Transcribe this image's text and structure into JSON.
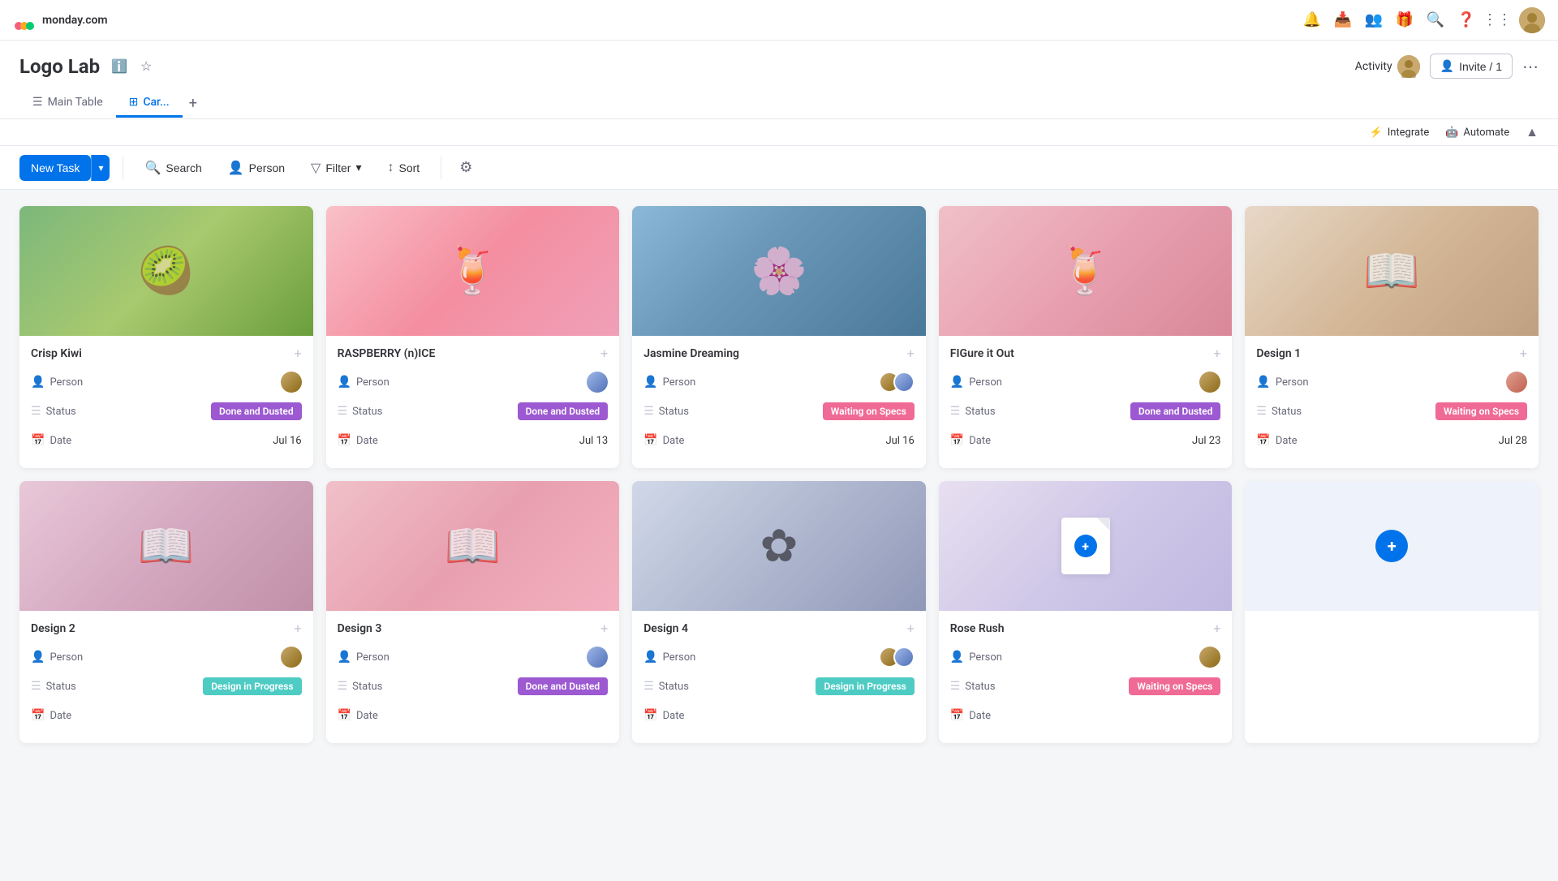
{
  "app": {
    "logo_text": "monday.com",
    "project_title": "Logo Lab"
  },
  "header": {
    "activity_label": "Activity",
    "invite_label": "Invite / 1"
  },
  "tabs": [
    {
      "id": "main-table",
      "label": "Main Table",
      "icon": "☰",
      "active": false
    },
    {
      "id": "card-view",
      "label": "Car...",
      "icon": "⊞",
      "active": true
    }
  ],
  "integrate_bar": {
    "integrate_label": "Integrate",
    "automate_label": "Automate"
  },
  "toolbar": {
    "new_task_label": "New Task",
    "search_label": "Search",
    "person_label": "Person",
    "filter_label": "Filter",
    "sort_label": "Sort"
  },
  "status": {
    "done": "Done and Dusted",
    "waiting": "Waiting on Specs",
    "progress": "Design in Progress"
  },
  "cards": [
    {
      "id": "crisp-kiwi",
      "title": "Crisp Kiwi",
      "bg": "bg-crisp-kiwi",
      "art": "🥝",
      "person_label": "Person",
      "status_label": "Status",
      "status_type": "done",
      "date_label": "Date",
      "date_value": "Jul 16",
      "avatar": "1"
    },
    {
      "id": "raspberry",
      "title": "RASPBERRY (n)ICE",
      "bg": "bg-raspberry",
      "art": "🍹",
      "person_label": "Person",
      "status_label": "Status",
      "status_type": "done",
      "date_label": "Date",
      "date_value": "Jul 13",
      "avatar": "2"
    },
    {
      "id": "jasmine",
      "title": "Jasmine Dreaming",
      "bg": "bg-jasmine",
      "art": "🌸",
      "person_label": "Person",
      "status_label": "Status",
      "status_type": "waiting",
      "date_label": "Date",
      "date_value": "Jul 16",
      "avatar": "multi"
    },
    {
      "id": "figure",
      "title": "FIGure it Out",
      "bg": "bg-figure",
      "art": "🍹",
      "person_label": "Person",
      "status_label": "Status",
      "status_type": "done",
      "date_label": "Date",
      "date_value": "Jul 23",
      "avatar": "1"
    },
    {
      "id": "design1",
      "title": "Design 1",
      "bg": "bg-design1",
      "art": "📖",
      "person_label": "Person",
      "status_label": "Status",
      "status_type": "waiting",
      "date_label": "Date",
      "date_value": "Jul 28",
      "avatar": "3"
    },
    {
      "id": "design2",
      "title": "Design 2",
      "bg": "bg-design2",
      "art": "📖",
      "person_label": "Person",
      "status_label": "Status",
      "status_type": "progress",
      "date_label": "Date",
      "date_value": "",
      "avatar": "1"
    },
    {
      "id": "design3",
      "title": "Design 3",
      "bg": "bg-design3",
      "art": "📖",
      "person_label": "Person",
      "status_label": "Status",
      "status_type": "done",
      "date_label": "Date",
      "date_value": "",
      "avatar": "2"
    },
    {
      "id": "design4",
      "title": "Design 4",
      "bg": "bg-design4",
      "art": "✿",
      "person_label": "Person",
      "status_label": "Status",
      "status_type": "progress",
      "date_label": "Date",
      "date_value": "",
      "avatar": "multi"
    },
    {
      "id": "rose-rush",
      "title": "Rose Rush",
      "bg": "bg-rose-rush",
      "art": "doc",
      "person_label": "Person",
      "status_label": "Status",
      "status_type": "waiting",
      "date_label": "Date",
      "date_value": "",
      "avatar": "1"
    }
  ]
}
